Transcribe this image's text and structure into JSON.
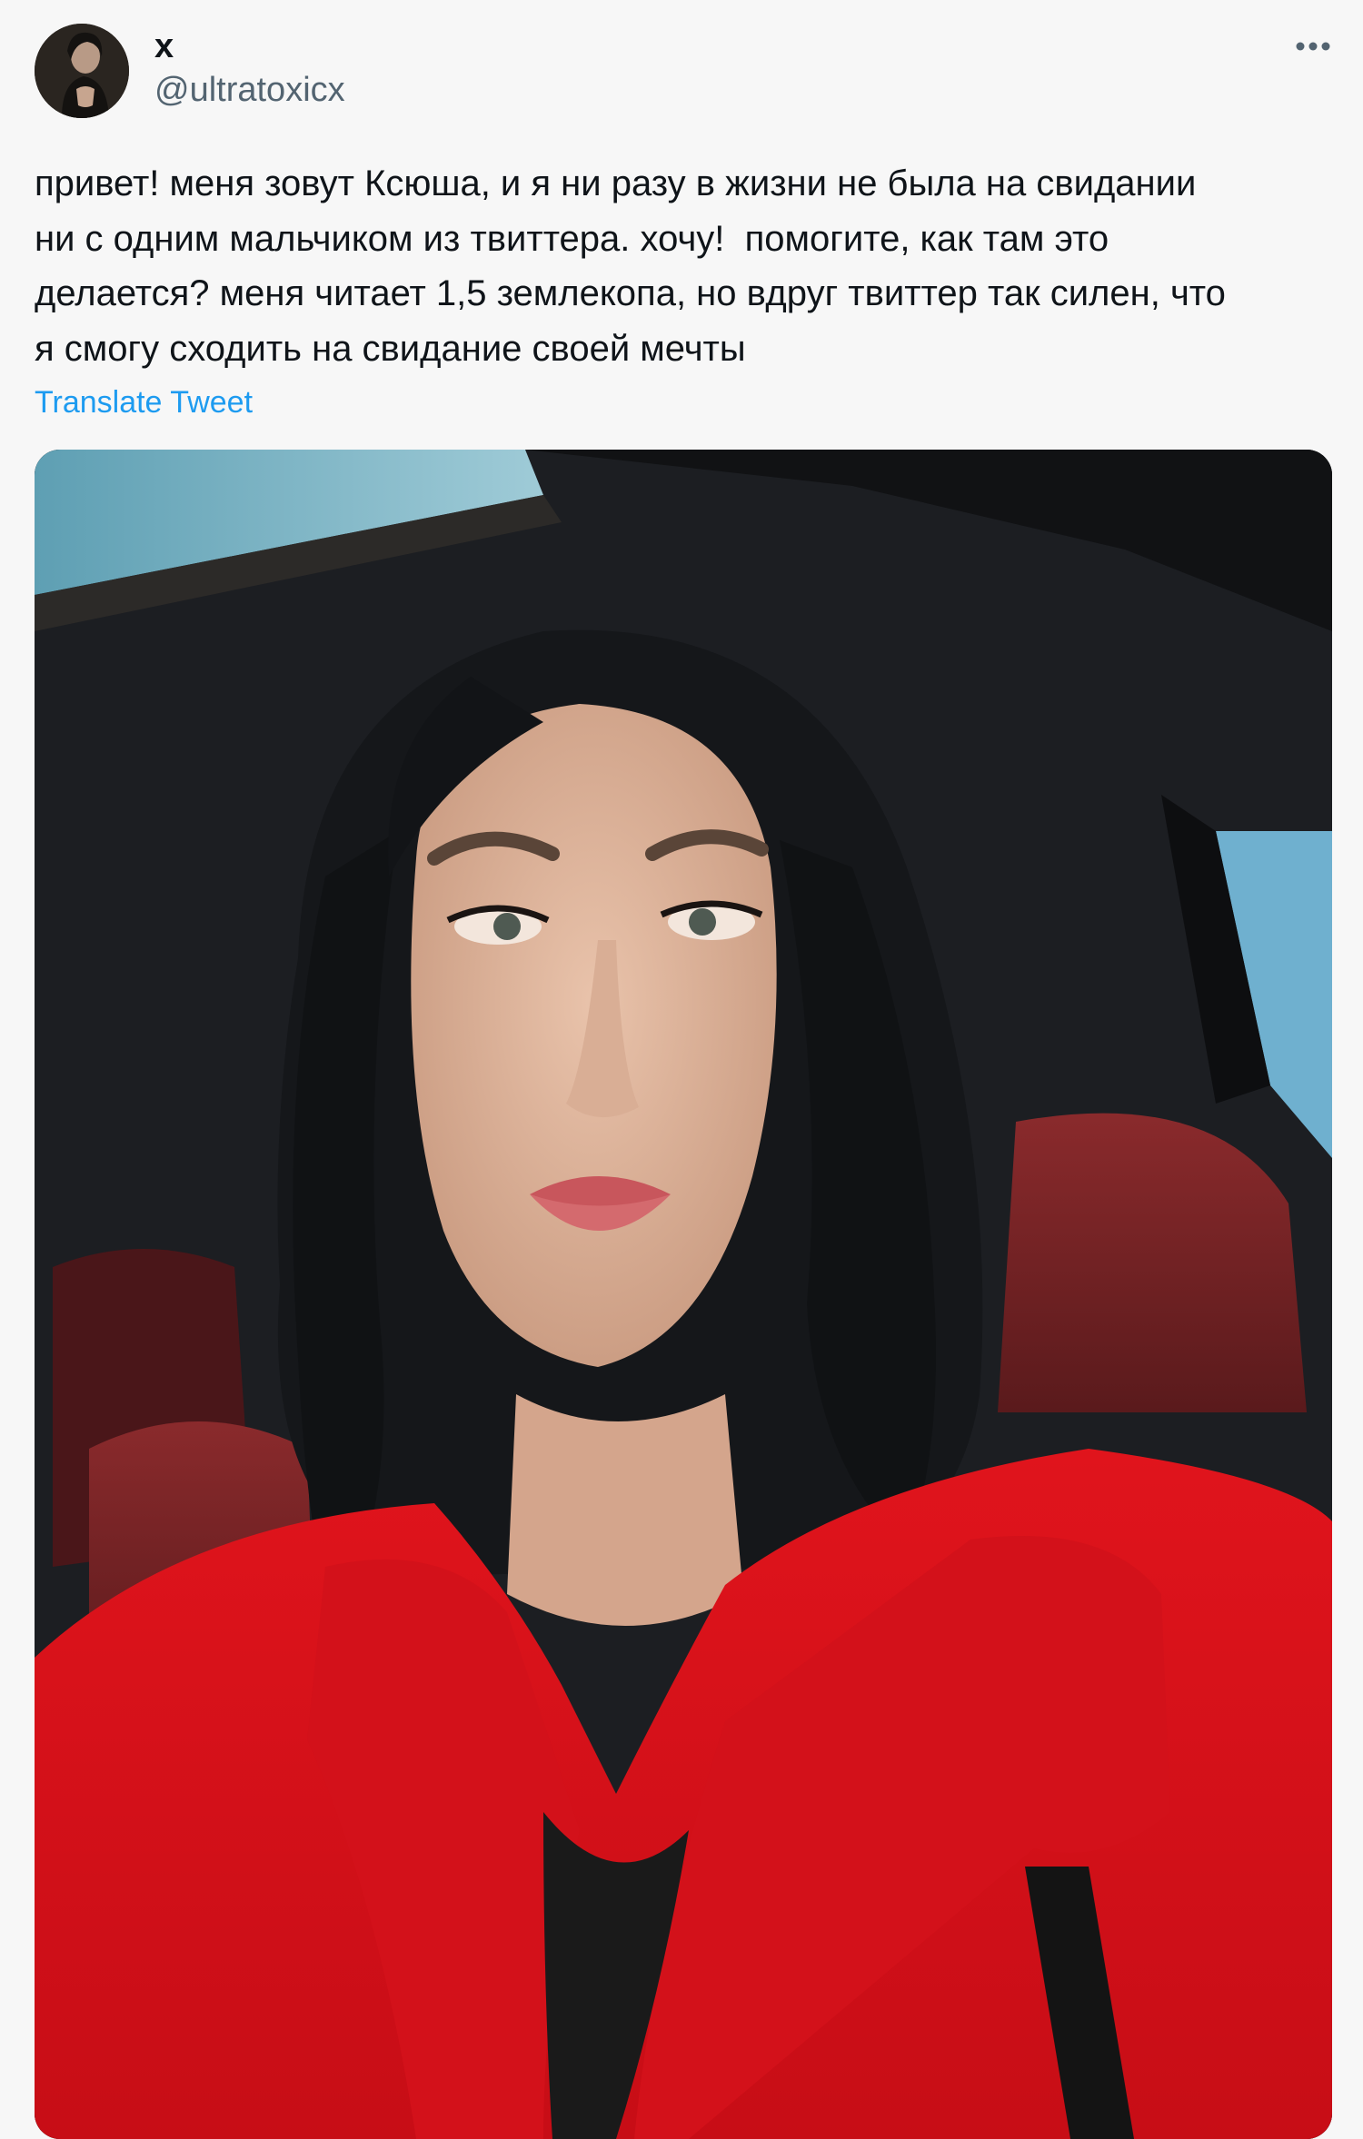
{
  "tweet": {
    "display_name": "x",
    "handle": "@ultratoxicx",
    "text_lines": [
      "привет! меня зовут Ксюша, и я ни разу в жизни не была на свидании",
      "ни с одним мальчиком из твиттера. хочу!  помогите, как там это",
      "делается? меня читает 1,5 землекопа, но вдруг твиттер так силен, что",
      "я смогу сходить на свидание своей мечты"
    ],
    "translate_label": "Translate Tweet",
    "avatar_icon": "user-avatar",
    "more_icon": "more-options-icon",
    "media_description_icon": "photo-icon"
  },
  "colors": {
    "background": "#f7f7f7",
    "text_primary": "#0f1419",
    "text_secondary": "#536471",
    "link": "#1d9bf0"
  }
}
